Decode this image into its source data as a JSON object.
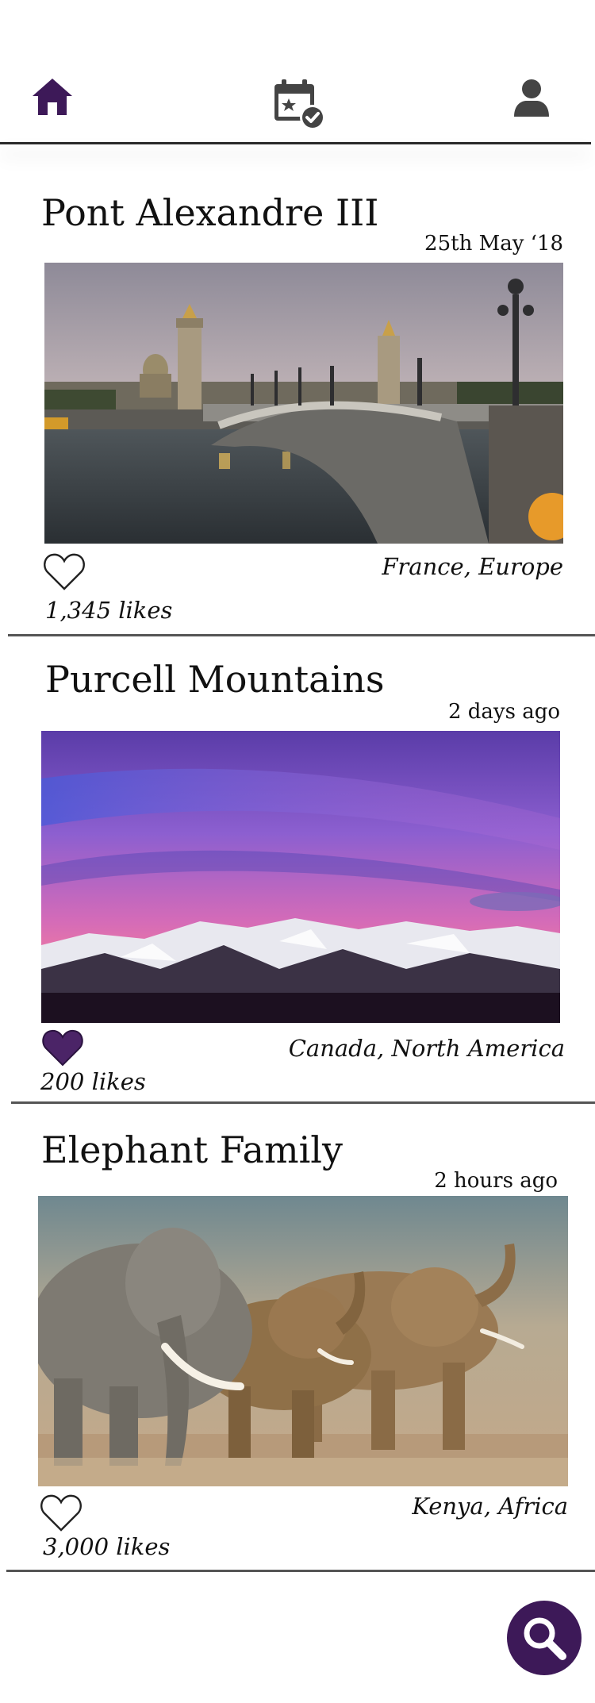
{
  "nav": {
    "items": [
      {
        "id": "home",
        "icon": "home-icon",
        "active": true
      },
      {
        "id": "calendar",
        "icon": "calendar-check-icon",
        "active": false
      },
      {
        "id": "profile",
        "icon": "person-icon",
        "active": false
      }
    ]
  },
  "posts": [
    {
      "title": "Pont Alexandre III",
      "date": "25th May ‘18",
      "image": "paris-bridge-photo",
      "liked": false,
      "location": "France, Europe",
      "likes": "1,345 likes"
    },
    {
      "title": "Purcell Mountains",
      "date": "2 days ago",
      "image": "purple-sky-mountains-photo",
      "liked": true,
      "location": "Canada, North America",
      "likes": "200 likes"
    },
    {
      "title": "Elephant Family",
      "date": "2 hours ago",
      "image": "elephant-herd-photo",
      "liked": false,
      "location": "Kenya, Africa",
      "likes": "3,000 likes"
    }
  ],
  "search": {
    "icon": "search-icon"
  },
  "colors": {
    "accent": "#3d1958",
    "icon_gray": "#444444",
    "liked_heart": "#4b2467",
    "divider": "#555555"
  }
}
